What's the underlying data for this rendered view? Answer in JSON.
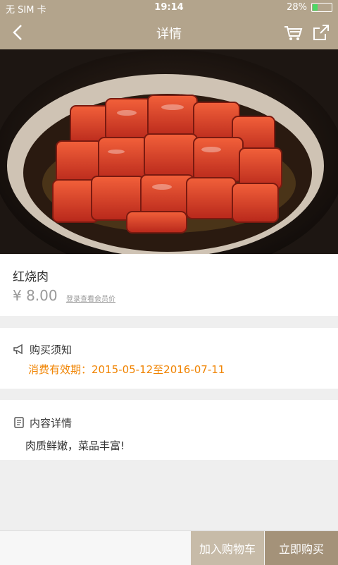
{
  "status_bar": {
    "carrier": "无 SIM 卡",
    "time": "19:14",
    "battery": "28%",
    "battery_level": 0.28
  },
  "header": {
    "title": "详情",
    "back_icon": "chevron-left-icon",
    "cart_icon": "shopping-cart-icon",
    "share_icon": "share-icon"
  },
  "product": {
    "name": "红烧肉",
    "price": "¥ 8.00",
    "member_link": "登录查看会员价"
  },
  "notice": {
    "title": "购买须知",
    "validity": "消费有效期：2015-05-12至2016-07-11"
  },
  "details": {
    "title": "内容详情",
    "text": "肉质鲜嫩，菜品丰富!"
  },
  "actions": {
    "add_to_cart": "加入购物车",
    "buy_now": "立即购买"
  },
  "colors": {
    "brand": "#b3a48c",
    "accent_orange": "#f08300",
    "button_light": "#c7bba8",
    "button_dark": "#a49279"
  }
}
